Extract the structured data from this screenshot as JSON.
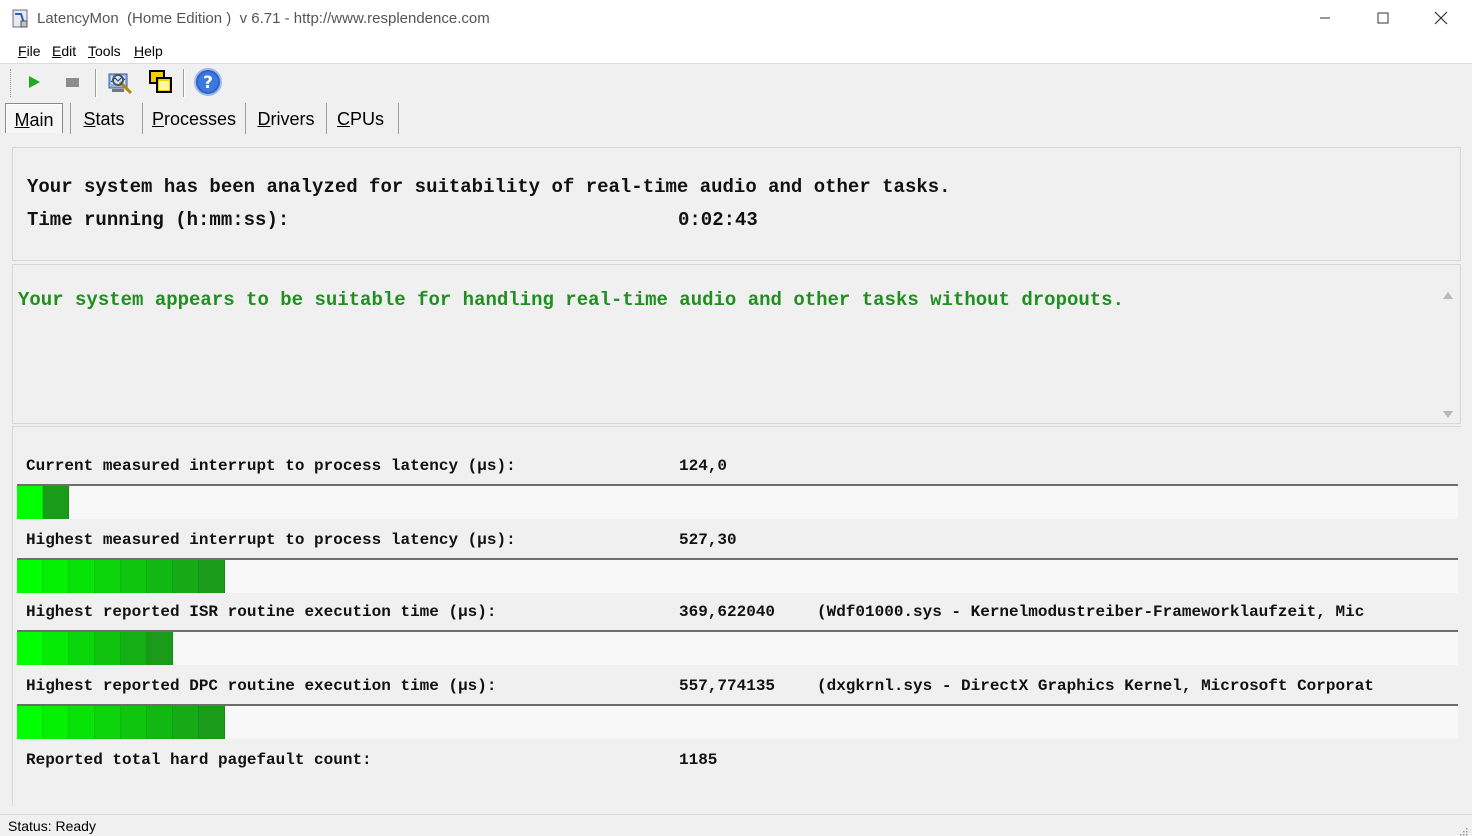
{
  "window": {
    "title": "LatencyMon  (Home Edition )  v 6.71 - http://www.resplendence.com",
    "minimize_icon": "minimize-icon",
    "maximize_icon": "maximize-icon",
    "close_icon": "close-icon"
  },
  "menu": [
    {
      "key": "F",
      "rest": "ile"
    },
    {
      "key": "E",
      "rest": "dit"
    },
    {
      "key": "T",
      "rest": "ools"
    },
    {
      "key": "H",
      "rest": "elp"
    }
  ],
  "toolbar": {
    "start_icon": "play-icon",
    "stop_icon": "stop-icon",
    "analyze_icon": "analyzer-icon",
    "window_icon": "windows-icon",
    "help_icon": "help-icon"
  },
  "tabs": [
    {
      "key": "M",
      "rest": "ain",
      "active": true
    },
    {
      "key": "S",
      "rest": "tats",
      "active": false
    },
    {
      "key": "P",
      "rest": "rocesses",
      "active": false
    },
    {
      "key": "D",
      "rest": "rivers",
      "active": false
    },
    {
      "key": "C",
      "rest": "PUs",
      "active": false
    }
  ],
  "summary": {
    "analyzed_text": "Your system has been analyzed for suitability of real-time audio and other tasks.",
    "time_label": "Time running (h:mm:ss):",
    "time_value": "0:02:43"
  },
  "verdict": {
    "text": "Your system appears to be suitable for handling real-time audio and other tasks without dropouts.",
    "color": "#1f8f1f"
  },
  "metrics": [
    {
      "label": "Current measured interrupt to process latency (µs):",
      "value": "124,0",
      "detail": "",
      "bar_segments": 2
    },
    {
      "label": "Highest measured interrupt to process latency (µs):",
      "value": "527,30",
      "detail": "",
      "bar_segments": 8
    },
    {
      "label": "Highest reported ISR routine execution time (µs):",
      "value": "369,622040",
      "detail": "(Wdf01000.sys - Kernelmodustreiber-Frameworklaufzeit, Mic",
      "bar_segments": 6
    },
    {
      "label": "Highest reported DPC routine execution time (µs):",
      "value": "557,774135",
      "detail": "(dxgkrnl.sys - DirectX Graphics Kernel, Microsoft Corporat",
      "bar_segments": 8
    }
  ],
  "pagefault": {
    "label": "Reported total hard pagefault count:",
    "value": "1185"
  },
  "colors": {
    "bar_bright": "#00ff00",
    "bar_dark": "#1e8a1e"
  },
  "status": {
    "text": "Status: Ready"
  }
}
